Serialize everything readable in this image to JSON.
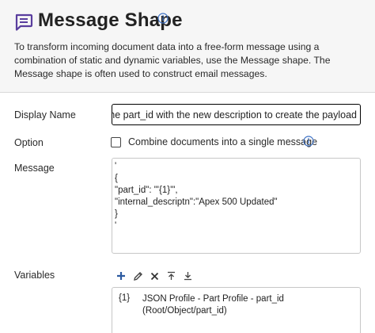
{
  "header": {
    "title": "Message Shape",
    "icon": "message-icon",
    "description": "To transform incoming document data into a free-form message using a combination of static and dynamic variables, use the Message shape. The Message shape is often used to construct email messages."
  },
  "form": {
    "display_name": {
      "label": "Display Name",
      "value": "Combine the part_id with the new description to create the payload"
    },
    "option": {
      "label": "Option",
      "checkbox_label": "Combine documents into a single message",
      "checked": false
    },
    "message": {
      "label": "Message",
      "lines": [
        "'",
        "{",
        "\"part_id\": \"'{1}'\",",
        "\"internal_descriptn\":\"Apex 500 Updated\"",
        "}",
        "'"
      ]
    },
    "variables": {
      "label": "Variables",
      "toolbar": [
        "add-icon",
        "edit-icon",
        "delete-icon",
        "move-top-icon",
        "move-bottom-icon"
      ],
      "items": [
        {
          "key": "{1}",
          "line1": "JSON Profile - Part Profile - part_id",
          "line2": "(Root/Object/part_id)"
        }
      ]
    }
  },
  "colors": {
    "accent": "#5a3e9e",
    "info": "#3f73c6",
    "toolbar": "#2c5aa0",
    "header_bg": "#f6f6f6"
  }
}
